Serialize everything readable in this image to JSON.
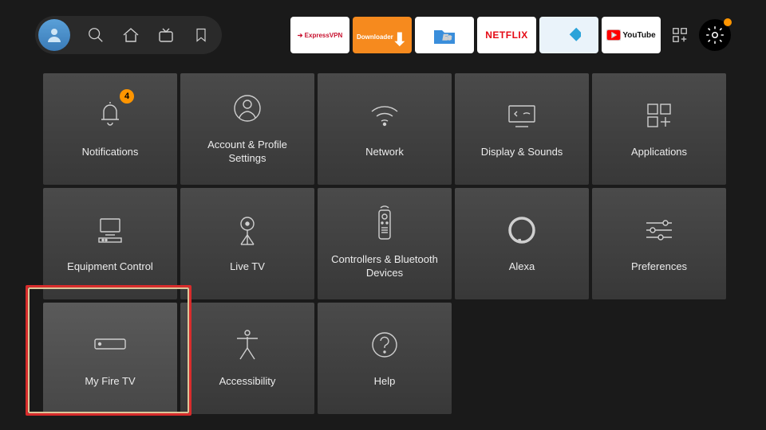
{
  "topApps": [
    {
      "name": "expressvpn",
      "bg": "#ffffff",
      "fg": "#c8102e",
      "text": "ExpressVPN"
    },
    {
      "name": "downloader",
      "bg": "#f68a1e",
      "fg": "#ffffff",
      "text": "Downloader"
    },
    {
      "name": "es-file",
      "bg": "#ffffff",
      "fg": "#2b7bd9",
      "text": ""
    },
    {
      "name": "netflix",
      "bg": "#ffffff",
      "fg": "#e50914",
      "text": "NETFLIX"
    },
    {
      "name": "kodi",
      "bg": "#eaf3fa",
      "fg": "#2aa3d9",
      "text": ""
    },
    {
      "name": "youtube",
      "bg": "#ffffff",
      "fg": "#000",
      "text": "YouTube"
    }
  ],
  "tiles": [
    {
      "id": "notifications",
      "label": "Notifications",
      "badge": "4"
    },
    {
      "id": "account",
      "label": "Account & Profile Settings"
    },
    {
      "id": "network",
      "label": "Network"
    },
    {
      "id": "display",
      "label": "Display & Sounds"
    },
    {
      "id": "applications",
      "label": "Applications"
    },
    {
      "id": "equipment",
      "label": "Equipment Control"
    },
    {
      "id": "livetv",
      "label": "Live TV"
    },
    {
      "id": "controllers",
      "label": "Controllers & Bluetooth Devices"
    },
    {
      "id": "alexa",
      "label": "Alexa"
    },
    {
      "id": "preferences",
      "label": "Preferences"
    },
    {
      "id": "myfiretv",
      "label": "My Fire TV",
      "selected": true
    },
    {
      "id": "accessibility",
      "label": "Accessibility"
    },
    {
      "id": "help",
      "label": "Help"
    }
  ]
}
